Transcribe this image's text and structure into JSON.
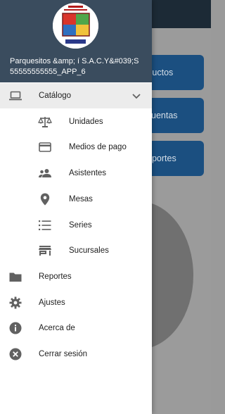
{
  "background": {
    "buttons": [
      {
        "label": "Productos"
      },
      {
        "label": "Cuentas"
      },
      {
        "label": "Reportes"
      }
    ]
  },
  "drawer": {
    "header": {
      "store_name": "Parquesitos &amp; í S.A.C.Y&#039;S",
      "store_sub": "55555555555_APP_6"
    },
    "catalog": {
      "label": "Catálogo",
      "icon": "laptop-icon",
      "expanded": true
    },
    "catalog_items": [
      {
        "label": "Unidades",
        "icon": "scale-icon"
      },
      {
        "label": "Medios de pago",
        "icon": "credit-card-icon"
      },
      {
        "label": "Asistentes",
        "icon": "people-icon"
      },
      {
        "label": "Mesas",
        "icon": "location-pin-icon"
      },
      {
        "label": "Series",
        "icon": "list-icon"
      },
      {
        "label": "Sucursales",
        "icon": "store-icon"
      }
    ],
    "items": [
      {
        "label": "Reportes",
        "icon": "folder-icon"
      },
      {
        "label": "Ajustes",
        "icon": "gear-icon"
      },
      {
        "label": "Acerca de",
        "icon": "info-icon"
      },
      {
        "label": "Cerrar sesión",
        "icon": "close-circle-icon"
      }
    ]
  },
  "colors": {
    "header_bg": "#3a4c5e",
    "active_row": "#ececec",
    "icon_gray": "#616161",
    "bg_button": "#1b4f80"
  }
}
